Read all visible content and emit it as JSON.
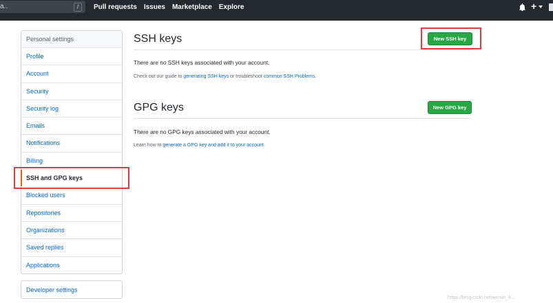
{
  "header": {
    "search_ellipsis": "a..",
    "slash_key": "/",
    "nav": [
      "Pull requests",
      "Issues",
      "Marketplace",
      "Explore"
    ]
  },
  "sidebar": {
    "title": "Personal settings",
    "items": [
      {
        "label": "Profile"
      },
      {
        "label": "Account"
      },
      {
        "label": "Security"
      },
      {
        "label": "Security log"
      },
      {
        "label": "Emails"
      },
      {
        "label": "Notifications"
      },
      {
        "label": "Billing"
      },
      {
        "label": "SSH and GPG keys"
      },
      {
        "label": "Blocked users"
      },
      {
        "label": "Repositories"
      },
      {
        "label": "Organizations"
      },
      {
        "label": "Saved replies"
      },
      {
        "label": "Applications"
      }
    ],
    "developer_settings": "Developer settings"
  },
  "ssh": {
    "title": "SSH keys",
    "button": "New SSH key",
    "empty": "There are no SSH keys associated with your account.",
    "note_prefix": "Check out our guide to ",
    "note_link1": "generating SSH keys",
    "note_mid": " or troubleshoot ",
    "note_link2": "common SSH Problems",
    "note_suffix": "."
  },
  "gpg": {
    "title": "GPG keys",
    "button": "New GPG key",
    "empty": "There are no GPG keys associated with your account.",
    "note_prefix": "Learn how to ",
    "note_link": "generate a GPG key and add it to your account",
    "note_suffix": "."
  },
  "watermark": "https://blog.csdn.net/weixin_4...",
  "colors": {
    "header_bg": "#24292e",
    "link": "#0366d6",
    "button_green": "#28a745",
    "highlight_red": "#e4393c",
    "selected_accent": "#e36209"
  },
  "icons": [
    "bell-icon",
    "plus-icon",
    "caret-down-icon"
  ]
}
